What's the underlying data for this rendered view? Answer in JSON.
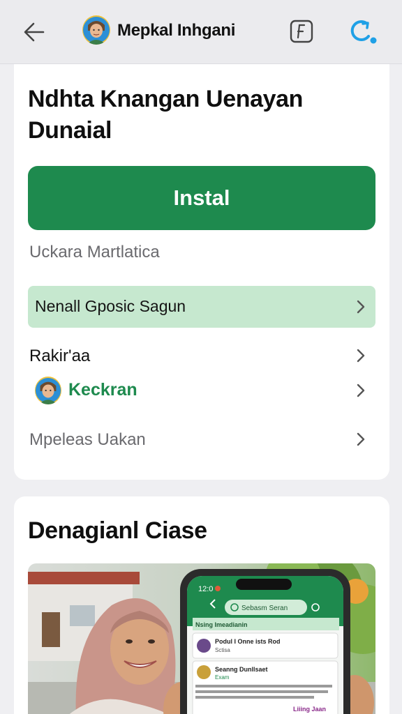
{
  "header": {
    "back_icon": "arrow-left-icon",
    "app_name": "Mepkal Inhgani",
    "tune_icon": "tune-square-icon",
    "refresh_icon": "refresh-icon"
  },
  "main": {
    "headline": "Ndhta Knangan Uenayan Dunaial",
    "install_label": "Instal",
    "subtitle": "Uckara Martlatica",
    "rows": [
      {
        "label": "Nenall Gposic Sagun",
        "highlighted": true
      },
      {
        "label": "Rakir'aa"
      },
      {
        "label": "Keckran",
        "has_avatar": true
      },
      {
        "label": "Mpeleas Uakan"
      }
    ]
  },
  "section": {
    "title": "Denagianl Ciase",
    "phone_screen": {
      "time": "12:0",
      "search_placeholder": "Sebasm Seran",
      "list_header": "Nsing Imeadianin",
      "post_1_title": "Podul I Onne ists Rod",
      "post_1_sub": "Sctisa",
      "post_2_title": "Seanng Dunllsaet",
      "post_2_tag": "Exam",
      "post_2_link": "Liiing Jaan"
    }
  },
  "colors": {
    "accent_green": "#1e8a4e",
    "highlight_green": "#c6e8cf",
    "refresh_blue": "#1fa0e6"
  }
}
